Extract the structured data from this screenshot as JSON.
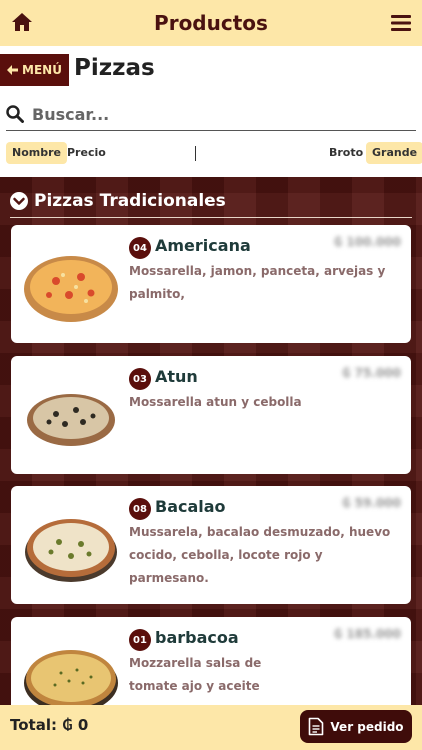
{
  "topbar": {
    "title": "Productos",
    "left_icon": "home-icon",
    "right_icon": "hamburger-menu-icon"
  },
  "header": {
    "back_label": "MENÚ",
    "back_icon": "arrow-left-icon",
    "page_title": "Pizzas"
  },
  "search": {
    "placeholder": "Buscar...",
    "value": "",
    "icon": "search-icon"
  },
  "sort": {
    "by_name": "Nombre",
    "by_price": "Precio",
    "size_small": "Broto",
    "size_large": "Grande"
  },
  "section": {
    "title": "Pizzas Tradicionales",
    "icon": "chevron-down-circle-icon"
  },
  "products": [
    {
      "number": "04",
      "name": "Americana",
      "price": "₲ 100.000",
      "description": "Mossarella, jamon, panceta, arvejas y palmito,"
    },
    {
      "number": "03",
      "name": "Atun",
      "price": "₲ 75.000",
      "description": "Mossarella atun y cebolla"
    },
    {
      "number": "08",
      "name": "Bacalao",
      "price": "₲ 59.000",
      "description": "Mussarela, bacalao desmuzado, huevo cocido, cebolla, locote rojo y parmesano."
    },
    {
      "number": "01",
      "name": "barbacoa",
      "price": "₲ 185.000",
      "description": "Mozzarella salsa de tomate ajo y aceite"
    }
  ],
  "footer": {
    "total_label": "Total:",
    "total_value": "₲ 0",
    "order_label": "Ver pedido",
    "order_icon": "document-icon"
  },
  "colors": {
    "accent": "#fde7a8",
    "dark": "#5a0f0c",
    "background": "#521512"
  }
}
